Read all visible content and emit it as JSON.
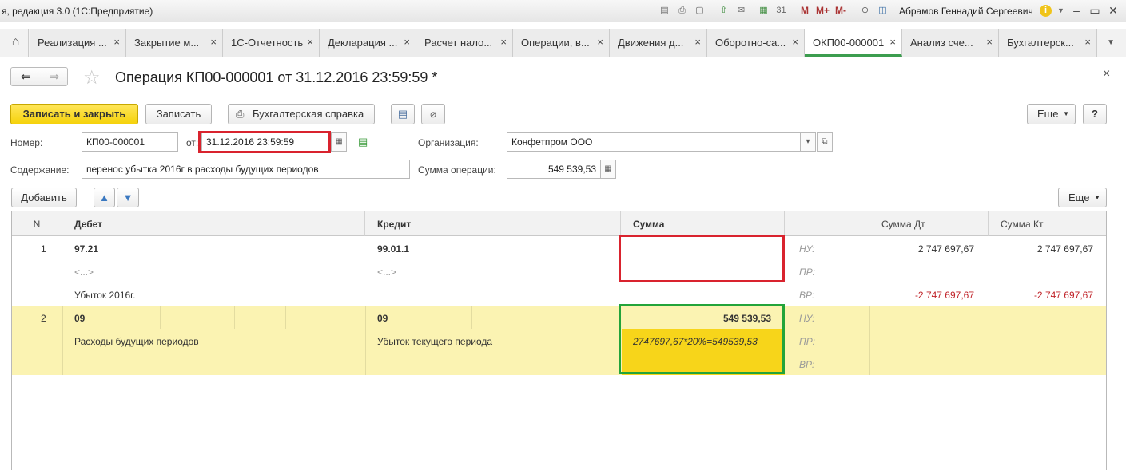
{
  "titlebar": {
    "app_title": "я, редакция 3.0  (1С:Предприятие)",
    "m_buttons": [
      "M",
      "M+",
      "M-"
    ],
    "user": "Абрамов Геннадий Сергеевич"
  },
  "tabs": [
    {
      "label": "Реализация ...",
      "close": "×"
    },
    {
      "label": "Закрытие м...",
      "close": "×"
    },
    {
      "label": "1С-Отчетность",
      "close": "×"
    },
    {
      "label": "Декларация ...",
      "close": "×"
    },
    {
      "label": "Расчет нало...",
      "close": "×"
    },
    {
      "label": "Операции, в...",
      "close": "×"
    },
    {
      "label": "Движения д...",
      "close": "×"
    },
    {
      "label": "Оборотно-са...",
      "close": "×"
    },
    {
      "label": "ОКП00-000001",
      "close": "×"
    },
    {
      "label": "Анализ сче...",
      "close": "×"
    },
    {
      "label": "Бухгалтерск...",
      "close": "×"
    }
  ],
  "header": {
    "title": "Операция КП00-000001 от 31.12.2016 23:59:59 *",
    "close": "×"
  },
  "toolbar": {
    "save_close": "Записать и закрыть",
    "save": "Записать",
    "report": "Бухгалтерская справка",
    "more": "Еще",
    "help": "?"
  },
  "form": {
    "number_label": "Номер:",
    "number_value": "КП00-000001",
    "date_label": "от:",
    "date_value": "31.12.2016 23:59:59",
    "org_label": "Организация:",
    "org_value": "Конфетпром ООО",
    "content_label": "Содержание:",
    "content_value": "перенос убытка 2016г в расходы будущих периодов",
    "sum_label": "Сумма операции:",
    "sum_value": "549 539,53"
  },
  "table_toolbar": {
    "add": "Добавить",
    "more": "Еще"
  },
  "table": {
    "headers": [
      "N",
      "Дебет",
      "Кредит",
      "Сумма",
      "",
      "Сумма Дт",
      "Сумма Кт"
    ],
    "rows": [
      {
        "n": "1",
        "debit": "97.21",
        "debit_sub": "<...>",
        "debit_desc": "Убыток 2016г.",
        "credit": "99.01.1",
        "credit_sub": "<...>",
        "sum": "",
        "sum_note": "",
        "tax_labels": [
          "НУ:",
          "ПР:",
          "ВР:"
        ],
        "dt_nu": "2 747 697,67",
        "kt_nu": "2 747 697,67",
        "dt_vr": "-2 747 697,67",
        "kt_vr": "-2 747 697,67"
      },
      {
        "n": "2",
        "debit": "09",
        "debit_desc": "Расходы будущих периодов",
        "credit": "09",
        "credit_desc": "Убыток текущего периода",
        "sum": "549 539,53",
        "sum_note": "2747697,67*20%=549539,53",
        "tax_labels": [
          "НУ:",
          "ПР:",
          "ВР:"
        ]
      }
    ]
  }
}
